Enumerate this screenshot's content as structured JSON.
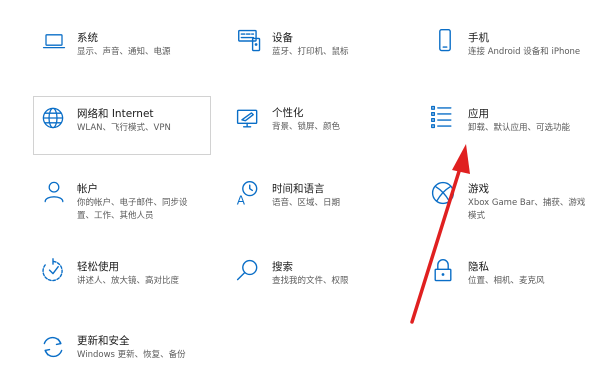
{
  "tiles": [
    {
      "title": "系统",
      "desc": "显示、声音、通知、电源",
      "icon": "laptop-icon"
    },
    {
      "title": "设备",
      "desc": "蓝牙、打印机、鼠标",
      "icon": "devices-icon"
    },
    {
      "title": "手机",
      "desc": "连接 Android 设备和 iPhone",
      "icon": "phone-icon"
    },
    {
      "title": "网络和 Internet",
      "desc": "WLAN、飞行模式、VPN",
      "icon": "globe-icon"
    },
    {
      "title": "个性化",
      "desc": "背景、锁屏、颜色",
      "icon": "personalization-icon"
    },
    {
      "title": "应用",
      "desc": "卸载、默认应用、可选功能",
      "icon": "apps-list-icon"
    },
    {
      "title": "帐户",
      "desc": "你的帐户、电子邮件、同步设置、工作、其他人员",
      "icon": "person-icon"
    },
    {
      "title": "时间和语言",
      "desc": "语音、区域、日期",
      "icon": "time-language-icon"
    },
    {
      "title": "游戏",
      "desc": "Xbox Game Bar、捕获、游戏模式",
      "icon": "xbox-icon"
    },
    {
      "title": "轻松使用",
      "desc": "讲述人、放大镜、高对比度",
      "icon": "ease-of-access-icon"
    },
    {
      "title": "搜索",
      "desc": "查找我的文件、权限",
      "icon": "search-icon"
    },
    {
      "title": "隐私",
      "desc": "位置、相机、麦克风",
      "icon": "lock-icon"
    },
    {
      "title": "更新和安全",
      "desc": "Windows 更新、恢复、备份",
      "icon": "sync-icon"
    }
  ],
  "accent_color": "#0a6ec7",
  "arrow_color": "#e02020"
}
